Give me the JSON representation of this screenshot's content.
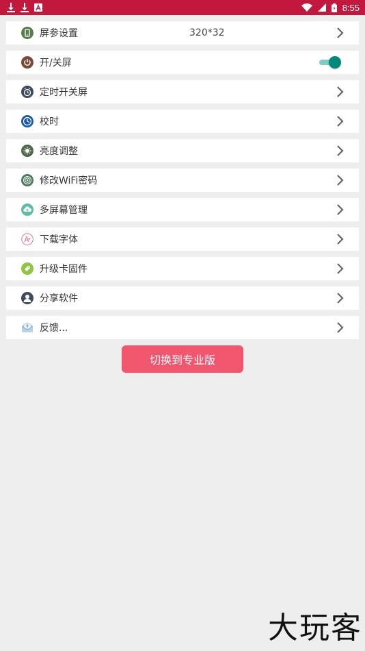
{
  "status_bar": {
    "time": "8:55",
    "left_icons": [
      "download-icon",
      "download-icon",
      "app-notification-icon"
    ],
    "right_icons": [
      "wifi-icon",
      "signal-icon",
      "battery-icon"
    ],
    "background": "#c2183e"
  },
  "menu": {
    "items": [
      {
        "label": "屏参设置",
        "value": "320*32",
        "icon": "phone-icon",
        "control": "chevron"
      },
      {
        "label": "开/关屏",
        "icon": "power-icon",
        "control": "toggle",
        "toggle_on": true
      },
      {
        "label": "定时开关屏",
        "icon": "timer-icon",
        "control": "chevron"
      },
      {
        "label": "校时",
        "icon": "clock-icon",
        "control": "chevron"
      },
      {
        "label": "亮度调整",
        "icon": "brightness-icon",
        "control": "chevron"
      },
      {
        "label": "修改WiFi密码",
        "icon": "wifi-password-icon",
        "control": "chevron"
      },
      {
        "label": "多屏幕管理",
        "icon": "cloud-upload-icon",
        "control": "chevron"
      },
      {
        "label": "下载字体",
        "icon": "font-icon",
        "control": "chevron"
      },
      {
        "label": "升级卡固件",
        "icon": "tag-icon",
        "control": "chevron"
      },
      {
        "label": "分享软件",
        "icon": "user-icon",
        "control": "chevron"
      },
      {
        "label": "反馈...",
        "icon": "mail-icon",
        "control": "chevron"
      }
    ]
  },
  "pro_button": {
    "label": "切换到专业版",
    "color": "#f0576e"
  },
  "watermark": {
    "text": "大玩客"
  },
  "colors": {
    "toggle_on": "#00897b",
    "toggle_track": "#80cbc4",
    "background": "#eeeeee"
  }
}
